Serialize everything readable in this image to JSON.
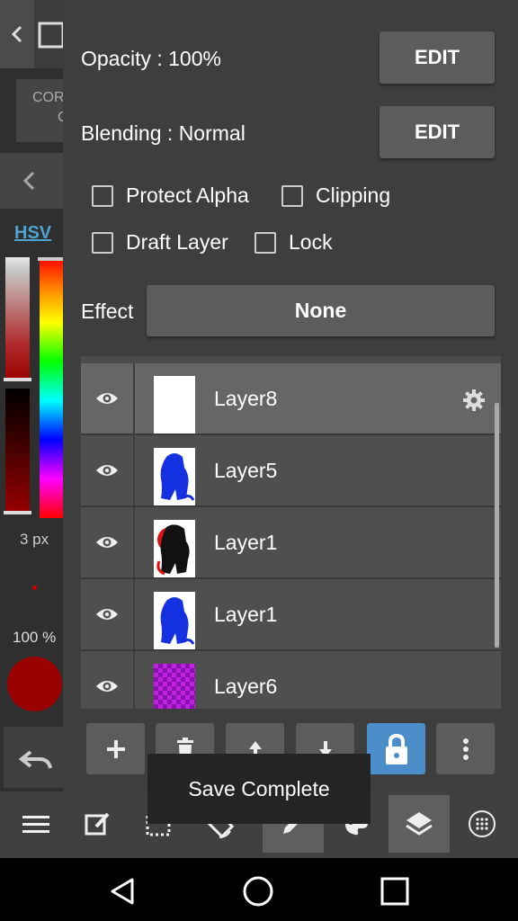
{
  "sidebar": {
    "corr_label": "COR",
    "corr_sub": "C",
    "color_mode": "HSV",
    "brush_size": "3 px",
    "opacity": "100 %",
    "color_hex": "#9a0000"
  },
  "layer_props": {
    "opacity_label": "Opacity : 100%",
    "opacity_edit": "EDIT",
    "blending_label": "Blending : Normal",
    "blending_edit": "EDIT",
    "protect_alpha": "Protect Alpha",
    "clipping": "Clipping",
    "draft_layer": "Draft Layer",
    "lock": "Lock",
    "effect_label": "Effect",
    "effect_value": "None"
  },
  "layers": [
    {
      "name": "Layer8",
      "selected": true,
      "thumb": "blank"
    },
    {
      "name": "Layer5",
      "selected": false,
      "thumb": "blue-figure"
    },
    {
      "name": "Layer1",
      "selected": false,
      "thumb": "black-red-figure"
    },
    {
      "name": "Layer1",
      "selected": false,
      "thumb": "blue-figure"
    },
    {
      "name": "Layer6",
      "selected": false,
      "thumb": "purple-checker"
    }
  ],
  "actions": [
    "add-icon",
    "trash-icon",
    "arrow-up-icon",
    "arrow-down-icon",
    "lock-icon",
    "more-icon"
  ],
  "toast": "Save Complete",
  "toolbar": [
    "menu-icon",
    "edit-icon",
    "selection-icon",
    "rotate-icon",
    "pen-icon",
    "palette-icon",
    "layers-icon",
    "grid-icon"
  ],
  "nav": [
    "back-icon",
    "home-icon",
    "recents-icon"
  ],
  "colors": {
    "accent": "#4c8ec9",
    "panel": "#3e3e3e",
    "button": "#5c5c5c"
  }
}
